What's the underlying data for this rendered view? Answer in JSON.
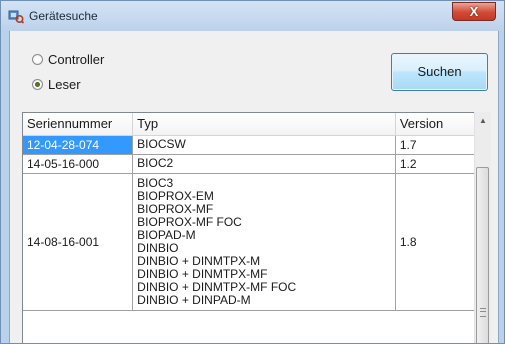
{
  "window": {
    "title": "Gerätesuche",
    "close_label": "X"
  },
  "mode": {
    "options": [
      {
        "label": "Controller",
        "checked": false
      },
      {
        "label": "Leser",
        "checked": true
      }
    ]
  },
  "search_button": {
    "label": "Suchen"
  },
  "table": {
    "columns": [
      "Seriennummer",
      "Typ",
      "Version"
    ],
    "rows": [
      {
        "serial": "12-04-28-074",
        "types": [
          "BIOCSW"
        ],
        "version": "1.7",
        "selected": true
      },
      {
        "serial": "14-05-16-000",
        "types": [
          "BIOC2"
        ],
        "version": "1.2",
        "selected": false
      },
      {
        "serial": "14-08-16-001",
        "types": [
          "BIOC3",
          "BIOPROX-EM",
          "BIOPROX-MF",
          "BIOPROX-MF FOC",
          "BIOPAD-M",
          "DINBIO",
          "DINBIO + DINMTPX-M",
          "DINBIO + DINMTPX-MF",
          "DINBIO + DINMTPX-MF FOC",
          "DINBIO + DINPAD-M"
        ],
        "version": "1.8",
        "selected": false
      }
    ]
  },
  "scrollbar": {
    "up_arrow_icon": "arrow-up-icon",
    "grip_icon": "scroll-grip-icon"
  },
  "colors": {
    "selection": "#3399ff",
    "title_gradient": "#bcd2ea",
    "close_button": "#d24a35",
    "button_gradient": "#bee6fd"
  }
}
